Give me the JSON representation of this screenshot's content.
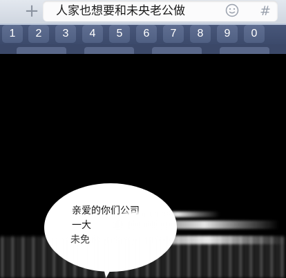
{
  "chat_input": {
    "plus_label": "+",
    "text": "人家也想要和未央老公做",
    "hash_label": "#"
  },
  "keyboard": {
    "number_keys": [
      "1",
      "2",
      "3",
      "4",
      "5",
      "6",
      "7",
      "8",
      "9",
      "0"
    ]
  },
  "bubble": {
    "line1": "亲爱的你们公司",
    "line2": "一大",
    "line3": "未免"
  },
  "colors": {
    "background": "#000000",
    "keyboard_row": "#48577a",
    "key": "#5f6e91",
    "input_field": "#fbfbfc"
  }
}
